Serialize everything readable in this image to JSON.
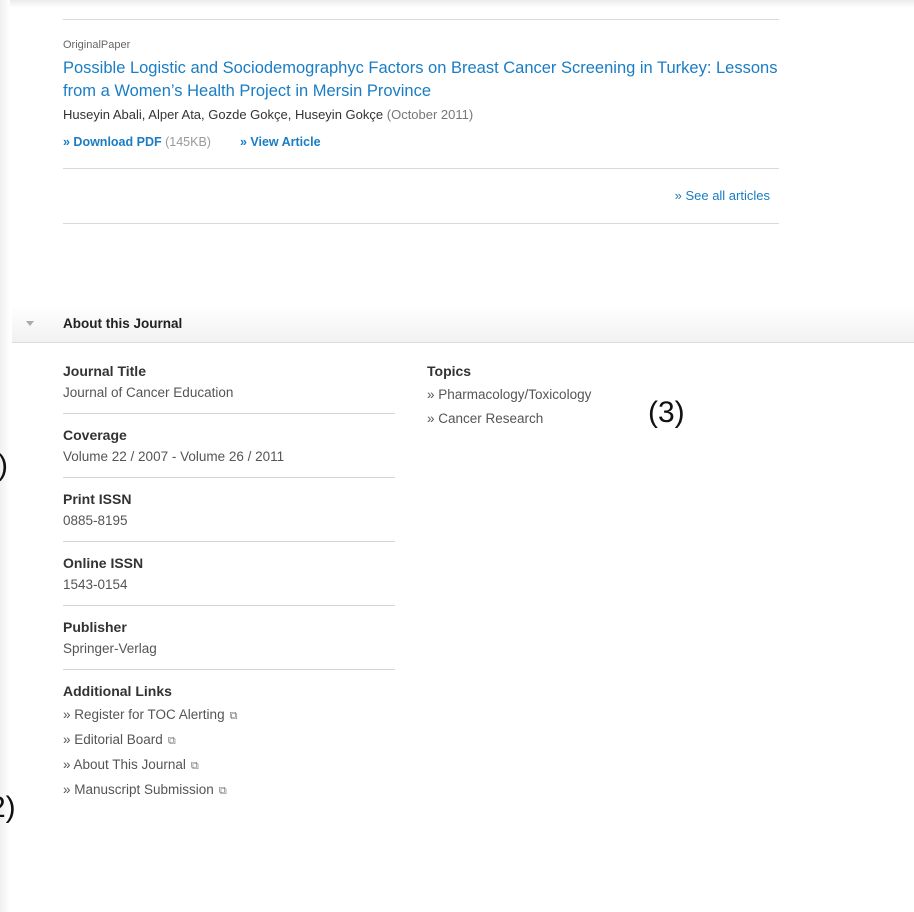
{
  "articles": [
    {
      "type": "OriginalPaper",
      "title": "Possible Logistic and Sociodemographyc Factors on Breast Cancer Screening in Turkey: Lessons from a Women’s Health Project in Mersin Province",
      "authors": "Huseyin Abali, Alper Ata, Gozde Gokçe, Huseyin Gokçe",
      "date": "(October 2011)",
      "download_label": "» Download PDF",
      "download_size": "(145KB)",
      "view_label": "» View Article"
    }
  ],
  "see_all_label": "» See all articles",
  "about": {
    "title": "About this Journal",
    "journal_title_label": "Journal Title",
    "journal_title": "Journal of Cancer Education",
    "coverage_label": "Coverage",
    "coverage": "Volume 22 / 2007 - Volume 26 / 2011",
    "print_issn_label": "Print ISSN",
    "print_issn": "0885-8195",
    "online_issn_label": "Online ISSN",
    "online_issn": "1543-0154",
    "publisher_label": "Publisher",
    "publisher": "Springer-Verlag",
    "additional_links_label": "Additional Links",
    "additional_links": [
      "» Register for TOC Alerting",
      "» Editorial Board",
      "» About This Journal",
      "» Manuscript Submission"
    ],
    "topics_label": "Topics",
    "topics": [
      "» Pharmacology/Toxicology",
      "» Cancer Research"
    ]
  },
  "markers": {
    "m3": "(3)",
    "m1": ")",
    "m2": "2)"
  },
  "icons": {
    "external_link": "external-link-icon",
    "toggle": "collapse-triangle-icon"
  },
  "colors": {
    "link": "#1a7dc4",
    "text": "#333333"
  }
}
